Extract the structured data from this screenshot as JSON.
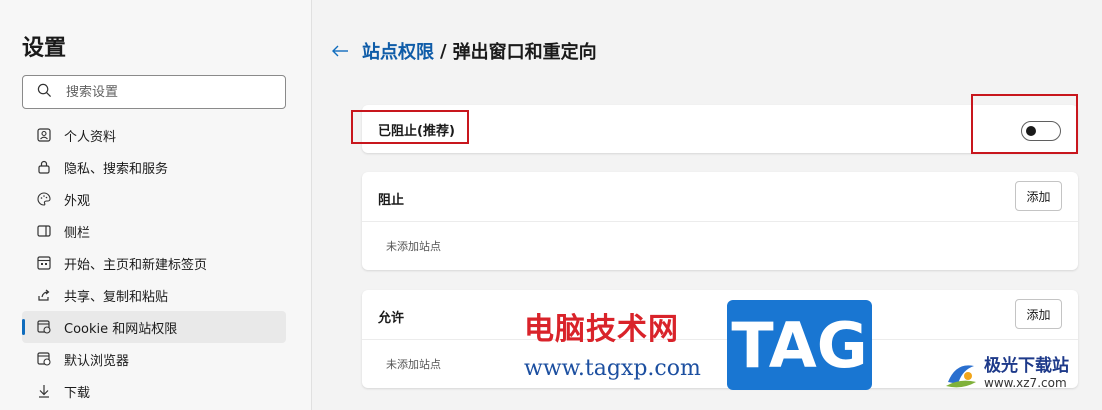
{
  "sidebar": {
    "title": "设置",
    "search_placeholder": "搜索设置",
    "items": [
      {
        "label": "个人资料",
        "icon": "profile-icon"
      },
      {
        "label": "隐私、搜索和服务",
        "icon": "lock-icon"
      },
      {
        "label": "外观",
        "icon": "palette-icon"
      },
      {
        "label": "侧栏",
        "icon": "sidebar-icon"
      },
      {
        "label": "开始、主页和新建标签页",
        "icon": "home-tabs-icon"
      },
      {
        "label": "共享、复制和粘贴",
        "icon": "share-icon"
      },
      {
        "label": "Cookie 和网站权限",
        "icon": "cookie-permissions-icon",
        "active": true
      },
      {
        "label": "默认浏览器",
        "icon": "browser-icon"
      },
      {
        "label": "下载",
        "icon": "download-icon"
      }
    ]
  },
  "header": {
    "breadcrumb_parent": "站点权限",
    "separator": "/",
    "current": "弹出窗口和重定向"
  },
  "blocked_setting": {
    "label": "已阻止(推荐)",
    "toggle_on": false
  },
  "block_list": {
    "title": "阻止",
    "add_label": "添加",
    "empty_text": "未添加站点"
  },
  "allow_list": {
    "title": "允许",
    "add_label": "添加",
    "empty_text": "未添加站点"
  },
  "watermark": {
    "cn_text": "电脑技术网",
    "url": "www.tagxp.com",
    "tag": "TAG",
    "site_name": "极光下载站",
    "site_url": "www.xz7.com"
  },
  "colors": {
    "accent": "#0f6cbd",
    "annotation": "#c8161d",
    "link": "#0f5ca8"
  }
}
